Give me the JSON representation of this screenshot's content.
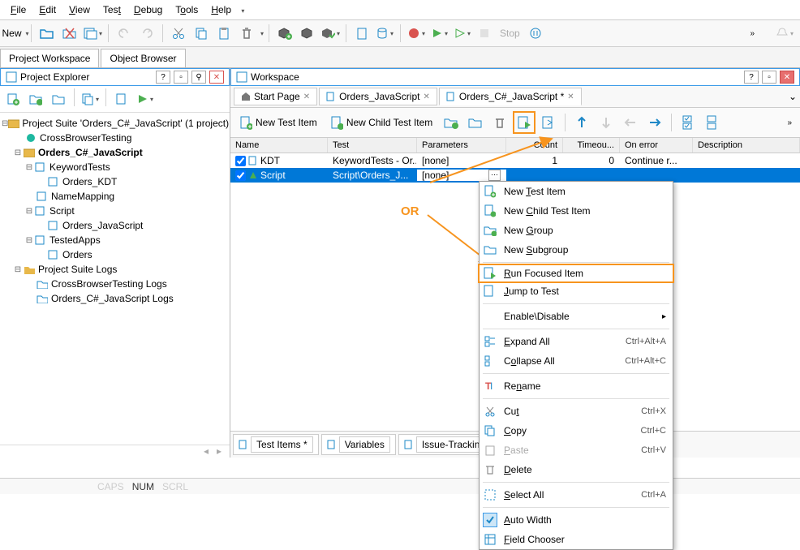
{
  "menu": {
    "items": [
      "File",
      "Edit",
      "View",
      "Test",
      "Debug",
      "Tools",
      "Help"
    ]
  },
  "toolbar": {
    "new": "New",
    "stop": "Stop"
  },
  "panelTabs": [
    "Project Workspace",
    "Object Browser"
  ],
  "explorer": {
    "title": "Project Explorer",
    "tree": {
      "suite": "Project Suite 'Orders_C#_JavaScript' (1 project)",
      "cbt": "CrossBrowserTesting",
      "proj": "Orders_C#_JavaScript",
      "kwt": "KeywordTests",
      "kwt_item": "Orders_KDT",
      "nm": "NameMapping",
      "script": "Script",
      "script_item": "Orders_JavaScript",
      "ta": "TestedApps",
      "ta_item": "Orders",
      "logs": "Project Suite Logs",
      "log1": "CrossBrowserTesting Logs",
      "log2": "Orders_C#_JavaScript Logs"
    }
  },
  "workspace": {
    "title": "Workspace",
    "tabs": [
      {
        "icon": "home",
        "label": "Start Page"
      },
      {
        "icon": "page",
        "label": "Orders_JavaScript"
      },
      {
        "icon": "page",
        "label": "Orders_C#_JavaScript *"
      }
    ],
    "toolbar": {
      "newTestItem": "New Test Item",
      "newChildTestItem": "New Child Test Item"
    },
    "gridHeaders": [
      "Name",
      "Test",
      "Parameters",
      "Count",
      "Timeou...",
      "On error",
      "Description"
    ],
    "rows": [
      {
        "name": "KDT",
        "test": "KeywordTests - Or...",
        "params": "[none]",
        "count": "1",
        "timeout": "0",
        "onerror": "Continue r..."
      },
      {
        "name": "Script",
        "test": "Script\\Orders_J...",
        "params": "[none]",
        "count": "",
        "timeout": "",
        "onerror": ""
      }
    ],
    "bottomTabs": [
      "Test Items *",
      "Variables",
      "Issue-Tracking Templat"
    ]
  },
  "context": {
    "items": [
      {
        "label": "New Test Item",
        "u": 4
      },
      {
        "label": "New Child Test Item",
        "u": 4
      },
      {
        "label": "New Group",
        "u": 4
      },
      {
        "label": "New Subgroup",
        "u": 4
      },
      {
        "sep": true
      },
      {
        "label": "Run Focused Item",
        "u": 0,
        "highlight": true
      },
      {
        "label": "Jump to Test",
        "u": 0
      },
      {
        "sep": true
      },
      {
        "label": "Enable\\Disable",
        "submenu": true
      },
      {
        "sep": true
      },
      {
        "label": "Expand All",
        "u": 0,
        "shortcut": "Ctrl+Alt+A"
      },
      {
        "label": "Collapse All",
        "u": 1,
        "shortcut": "Ctrl+Alt+C"
      },
      {
        "sep": true
      },
      {
        "label": "Rename",
        "u": 2
      },
      {
        "sep": true
      },
      {
        "label": "Cut",
        "u": 2,
        "shortcut": "Ctrl+X"
      },
      {
        "label": "Copy",
        "u": 0,
        "shortcut": "Ctrl+C"
      },
      {
        "label": "Paste",
        "u": 0,
        "shortcut": "Ctrl+V",
        "disabled": true
      },
      {
        "label": "Delete",
        "u": 0
      },
      {
        "sep": true
      },
      {
        "label": "Select All",
        "u": 0,
        "shortcut": "Ctrl+A"
      },
      {
        "sep": true
      },
      {
        "label": "Auto Width",
        "u": 0,
        "checked": true
      },
      {
        "label": "Field Chooser",
        "u": 0
      }
    ]
  },
  "annotation": {
    "or": "OR"
  },
  "status": {
    "caps": "CAPS",
    "num": "NUM",
    "scrl": "SCRL"
  }
}
